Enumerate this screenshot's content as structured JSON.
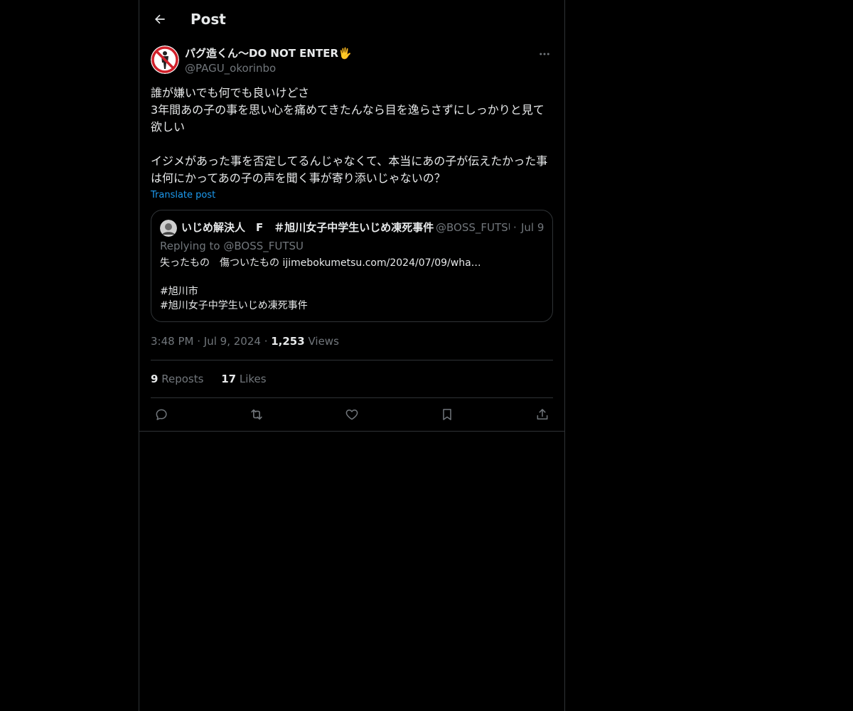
{
  "header": {
    "title": "Post"
  },
  "post": {
    "author_name": "パグ造くん〜DO NOT ENTER🖐",
    "author_handle": "@PAGU_okorinbo",
    "text": "誰が嫌いでも何でも良いけどさ\n3年間あの子の事を思い心を痛めてきたんなら目を逸らさずにしっかりと見て欲しい\n\nイジメがあった事を否定してるんじゃなくて、本当にあの子が伝えたかった事は何にかってあの子の声を聞く事が寄り添いじゃないの？",
    "translate_label": "Translate post",
    "time": "3:48 PM",
    "date": "Jul 9, 2024",
    "views_count": "1,253",
    "views_label": "Views",
    "reposts_count": "9",
    "reposts_label": "Reposts",
    "likes_count": "17",
    "likes_label": "Likes"
  },
  "quote": {
    "author_name": "いじめ解決人　F　＃旭川女子中学生いじめ凍死事件",
    "author_handle": "@BOSS_FUTSU",
    "date": "Jul 9",
    "replying_prefix": "Replying to",
    "replying_handle": "@BOSS_FUTSU",
    "text": "失ったもの　傷ついたもの ijimebokumetsu.com/2024/07/09/wha…\n\n#旭川市\n#旭川女子中学生いじめ凍死事件"
  },
  "icons": {
    "back": "arrow-left-icon",
    "more": "more-horizontal-icon",
    "reply": "reply-icon",
    "repost": "repost-icon",
    "like": "heart-icon",
    "bookmark": "bookmark-icon",
    "share": "share-icon"
  },
  "colors": {
    "background": "#000000",
    "text": "#e7e9ea",
    "muted": "#71767b",
    "accent": "#1d9bf0",
    "border": "#2f3336"
  }
}
